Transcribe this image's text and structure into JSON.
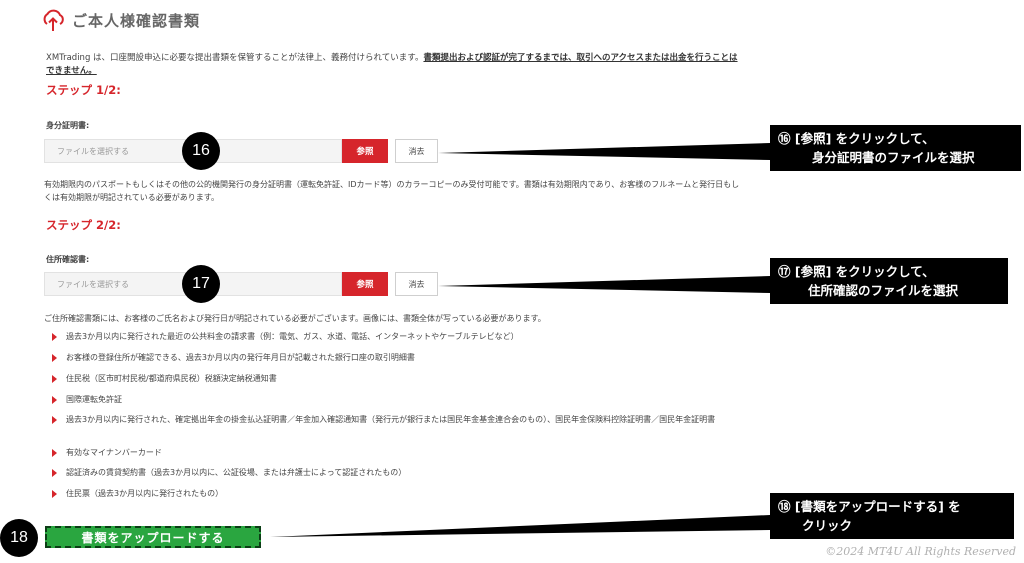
{
  "header": {
    "title": "ご本人様確認書類"
  },
  "intro": {
    "text": "XMTrading は、口座開設申込に必要な提出書類を保管することが法律上、義務付けられています。",
    "bold_text": "書類提出および認証が完了するまでは、取引へのアクセスまたは出金を行うことはできません。"
  },
  "step1": {
    "heading": "ステップ 1/2:",
    "label": "身分証明書:",
    "placeholder": "ファイルを選択する",
    "browse": "参照",
    "clear": "消去",
    "marker": "16",
    "note": "有効期限内のパスポートもしくはその他の公的機関発行の身分証明書（運転免許証、IDカード等）のカラーコピーのみ受付可能です。書類は有効期限内であり、お客様のフルネームと発行日もしくは有効期限が明記されている必要があります。"
  },
  "step2": {
    "heading": "ステップ 2/2:",
    "label": "住所確認書:",
    "placeholder": "ファイルを選択する",
    "browse": "参照",
    "clear": "消去",
    "marker": "17",
    "note": "ご住所確認書類には、お客様のご氏名および発行日が明記されている必要がございます。画像には、書類全体が写っている必要があります。"
  },
  "documents": [
    "過去3か月以内に発行された最近の公共料金の請求書（例：電気、ガス、水道、電話、インターネットやケーブルテレビなど）",
    "お客様の登録住所が確認できる、過去3か月以内の発行年月日が記載された銀行口座の取引明細書",
    "住民税（区市町村民税/都道府県民税）税額決定納税通知書",
    "国際運転免許証",
    "過去3か月以内に発行された、確定拠出年金の掛金払込証明書／年金加入確認通知書（発行元が銀行または国民年金基金連合会のもの）、国民年金保険料控除証明書／国民年金証明書",
    "有効なマイナンバーカード",
    "認証済みの賃貸契約書（過去3か月以内に、公証役場、または弁護士によって認証されたもの）",
    "住民票（過去3か月以内に発行されたもの）"
  ],
  "upload": {
    "label": "書類をアップロードする",
    "marker": "18"
  },
  "callouts": {
    "c16": {
      "line1": "⑯ [参照] をクリックして、",
      "line2": "身分証明書のファイルを選択"
    },
    "c17": {
      "line1": "⑰ [参照] をクリックして、",
      "line2": "住所確認のファイルを選択"
    },
    "c18": {
      "line1": "⑱ [書類をアップロードする] を",
      "line2": "クリック"
    }
  },
  "copyright": "©2024 MT4U All Rights Reserved",
  "colors": {
    "accent": "#d6252b",
    "upload_green": "#2aa640",
    "callout_bg": "#000000"
  }
}
